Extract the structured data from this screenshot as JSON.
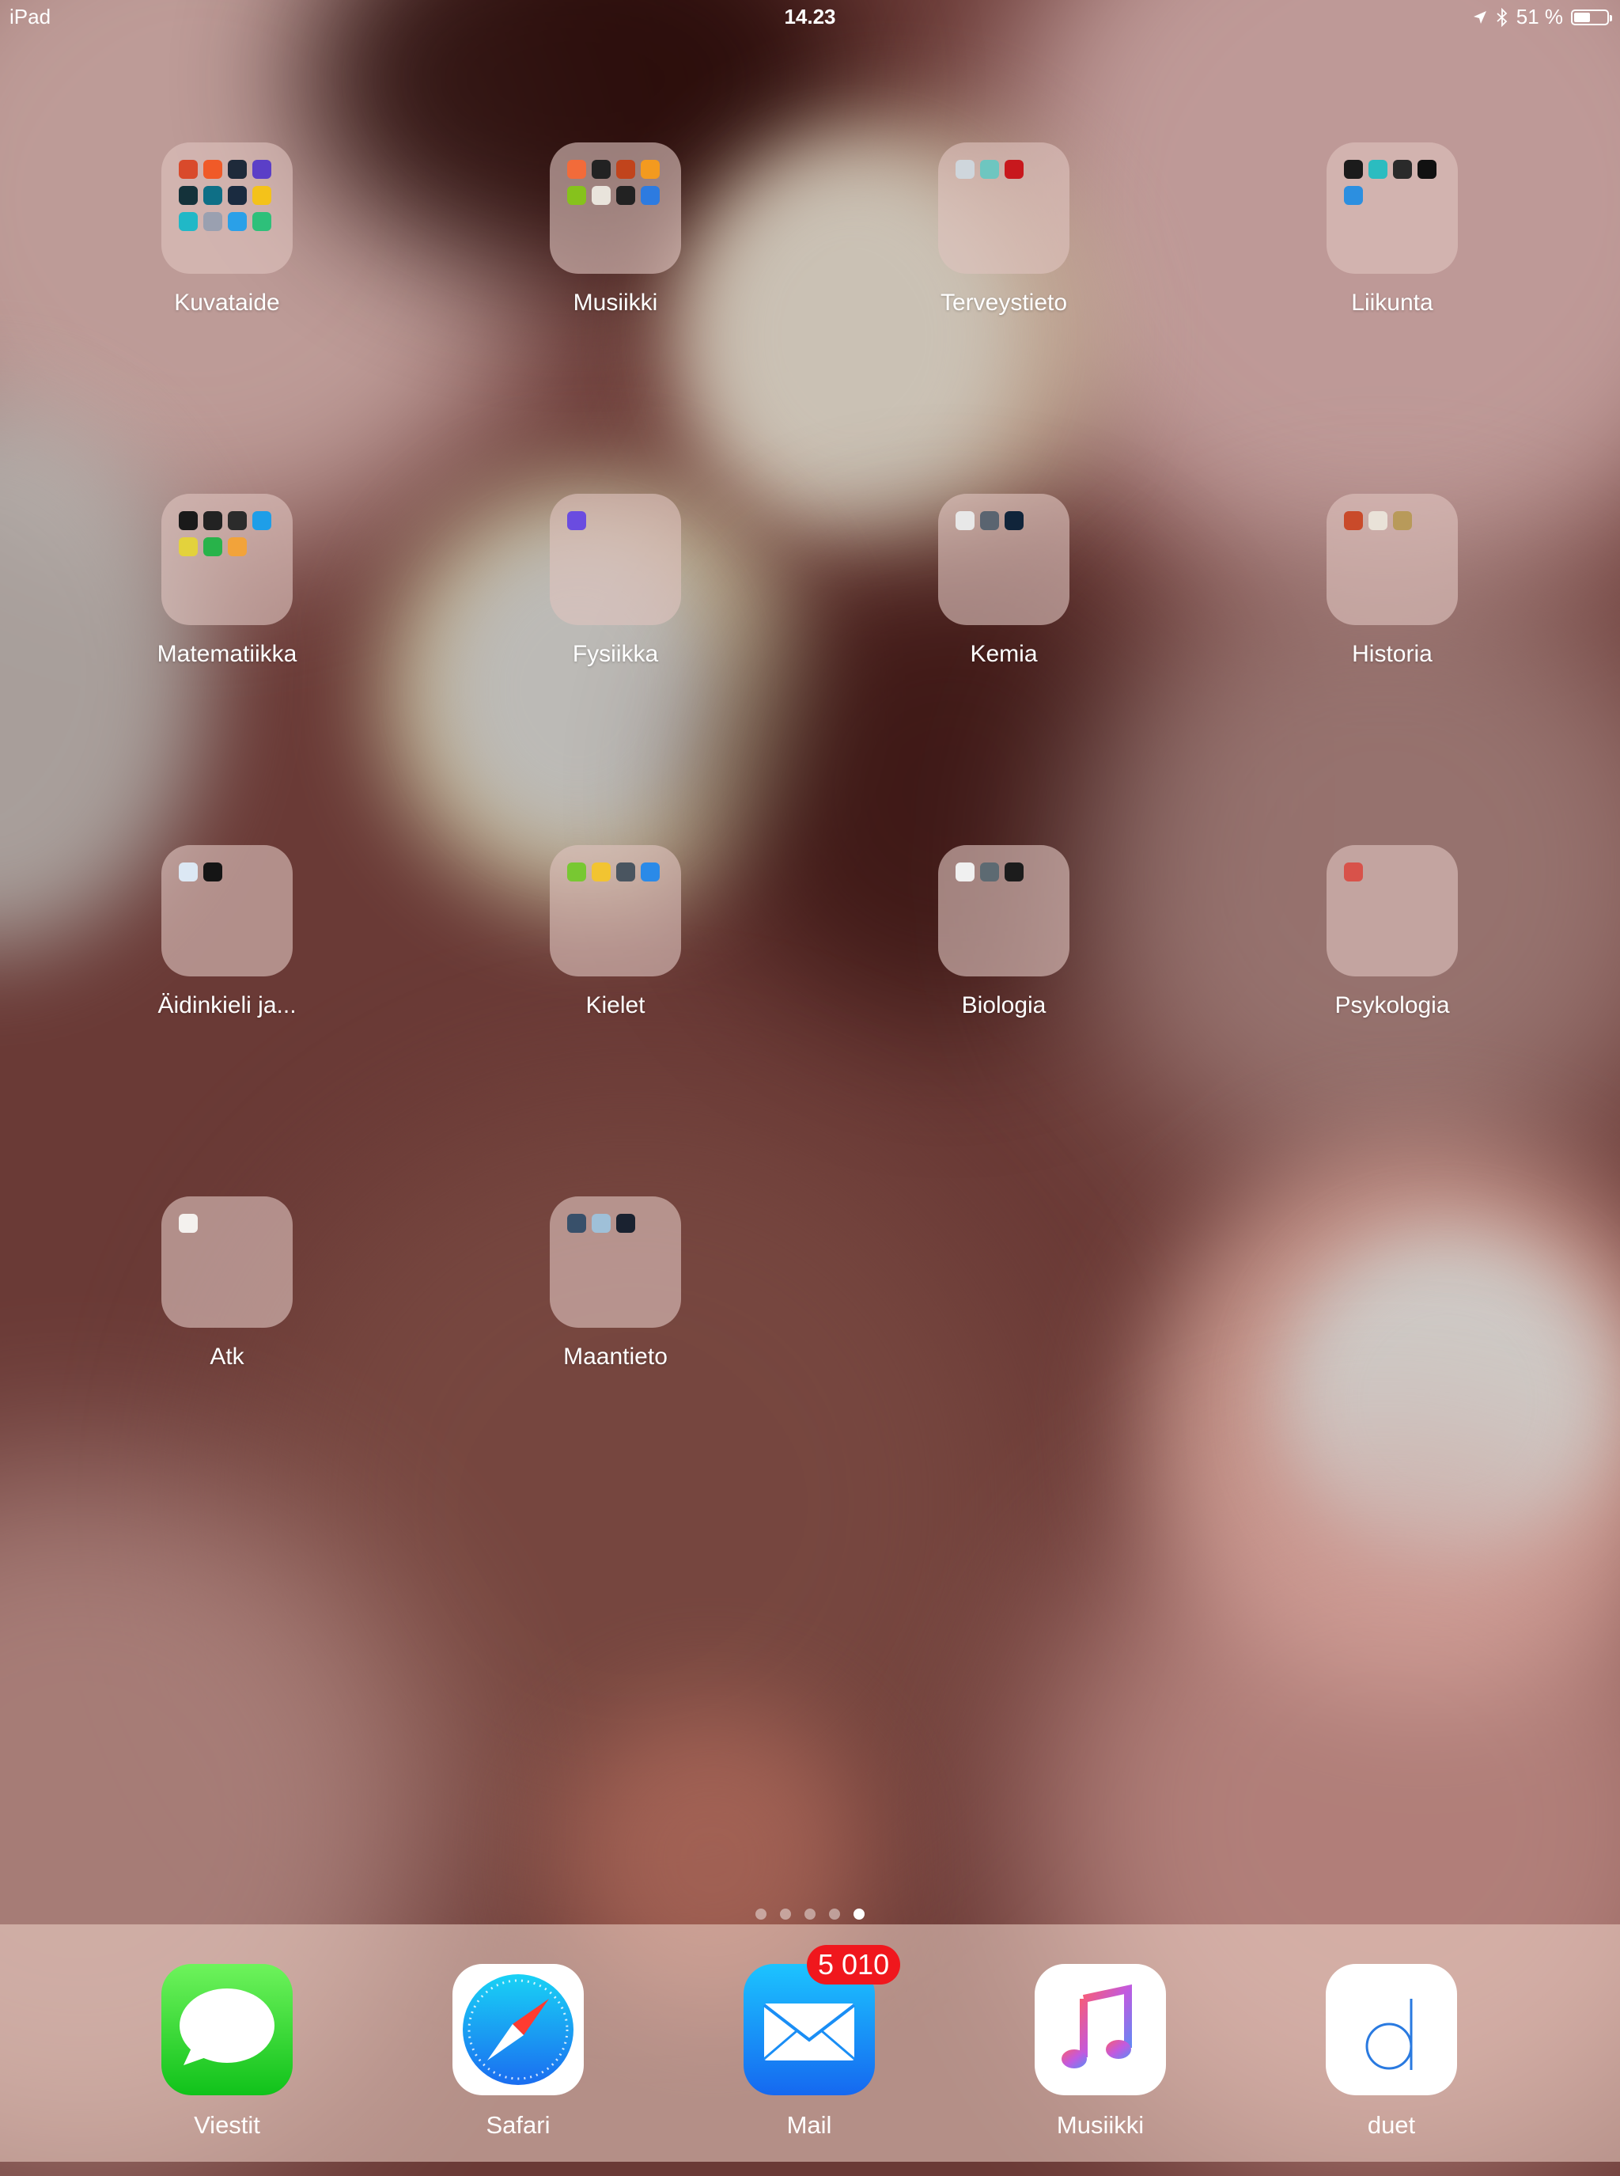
{
  "status_bar": {
    "device": "iPad",
    "time": "14.23",
    "battery_text": "51 %",
    "battery_level": 0.51,
    "icons": [
      "location-icon",
      "bluetooth-icon",
      "battery-icon"
    ]
  },
  "folders": [
    {
      "label": "Kuvataide",
      "apps": [
        "#d94a2b",
        "#f05a28",
        "#1e2a3a",
        "#5b3fc7",
        "#14323a",
        "#0e6f86",
        "#1a2b40",
        "#f4c21a",
        "#20b8c7",
        "#9aa0b0",
        "#2aa0e8",
        "#2ec07a"
      ]
    },
    {
      "label": "Musiikki",
      "apps": [
        "#f26b3a",
        "#222222",
        "#c1441c",
        "#f39a1f",
        "#86c21c",
        "#e9e4dc",
        "#222222",
        "#2d7be0"
      ]
    },
    {
      "label": "Terveystieto",
      "apps": [
        "#cfd6dc",
        "#6ec6c0",
        "#c8181d"
      ]
    },
    {
      "label": "Liikunta",
      "apps": [
        "#1b1b1b",
        "#2bbcc0",
        "#2a2a2a",
        "#111111",
        "#2c8fe0"
      ]
    },
    {
      "label": "Matematiikka",
      "apps": [
        "#1a1a1a",
        "#222222",
        "#2b2b2b",
        "#1e9ee8",
        "#e3d23c",
        "#28b34a",
        "#f2a33a"
      ]
    },
    {
      "label": "Fysiikka",
      "apps": [
        "#6a4ce0"
      ]
    },
    {
      "label": "Kemia",
      "apps": [
        "#e8e8e8",
        "#5a6470",
        "#10243a"
      ]
    },
    {
      "label": "Historia",
      "apps": [
        "#c94a2a",
        "#e9e2d8",
        "#b89a5a"
      ]
    },
    {
      "label": "Äidinkieli ja...",
      "apps": [
        "#dce8f4",
        "#151515"
      ]
    },
    {
      "label": "Kielet",
      "apps": [
        "#78c832",
        "#f2c431",
        "#4a5560",
        "#2a8ae8"
      ]
    },
    {
      "label": "Biologia",
      "apps": [
        "#f0f0f0",
        "#5d6a72",
        "#1c1c1c"
      ]
    },
    {
      "label": "Psykologia",
      "apps": [
        "#d8524a"
      ]
    },
    {
      "label": "Atk",
      "apps": [
        "#f4f1ee"
      ]
    },
    {
      "label": "Maantieto",
      "apps": [
        "#38506a",
        "#9fc0d8",
        "#1a2230"
      ]
    }
  ],
  "page_indicator": {
    "count": 5,
    "active_index": 4
  },
  "dock": [
    {
      "label": "Viestit",
      "icon": "messages-icon"
    },
    {
      "label": "Safari",
      "icon": "safari-icon"
    },
    {
      "label": "Mail",
      "icon": "mail-icon",
      "badge": "5 010"
    },
    {
      "label": "Musiikki",
      "icon": "music-icon"
    },
    {
      "label": "duet",
      "icon": "duet-icon"
    }
  ]
}
